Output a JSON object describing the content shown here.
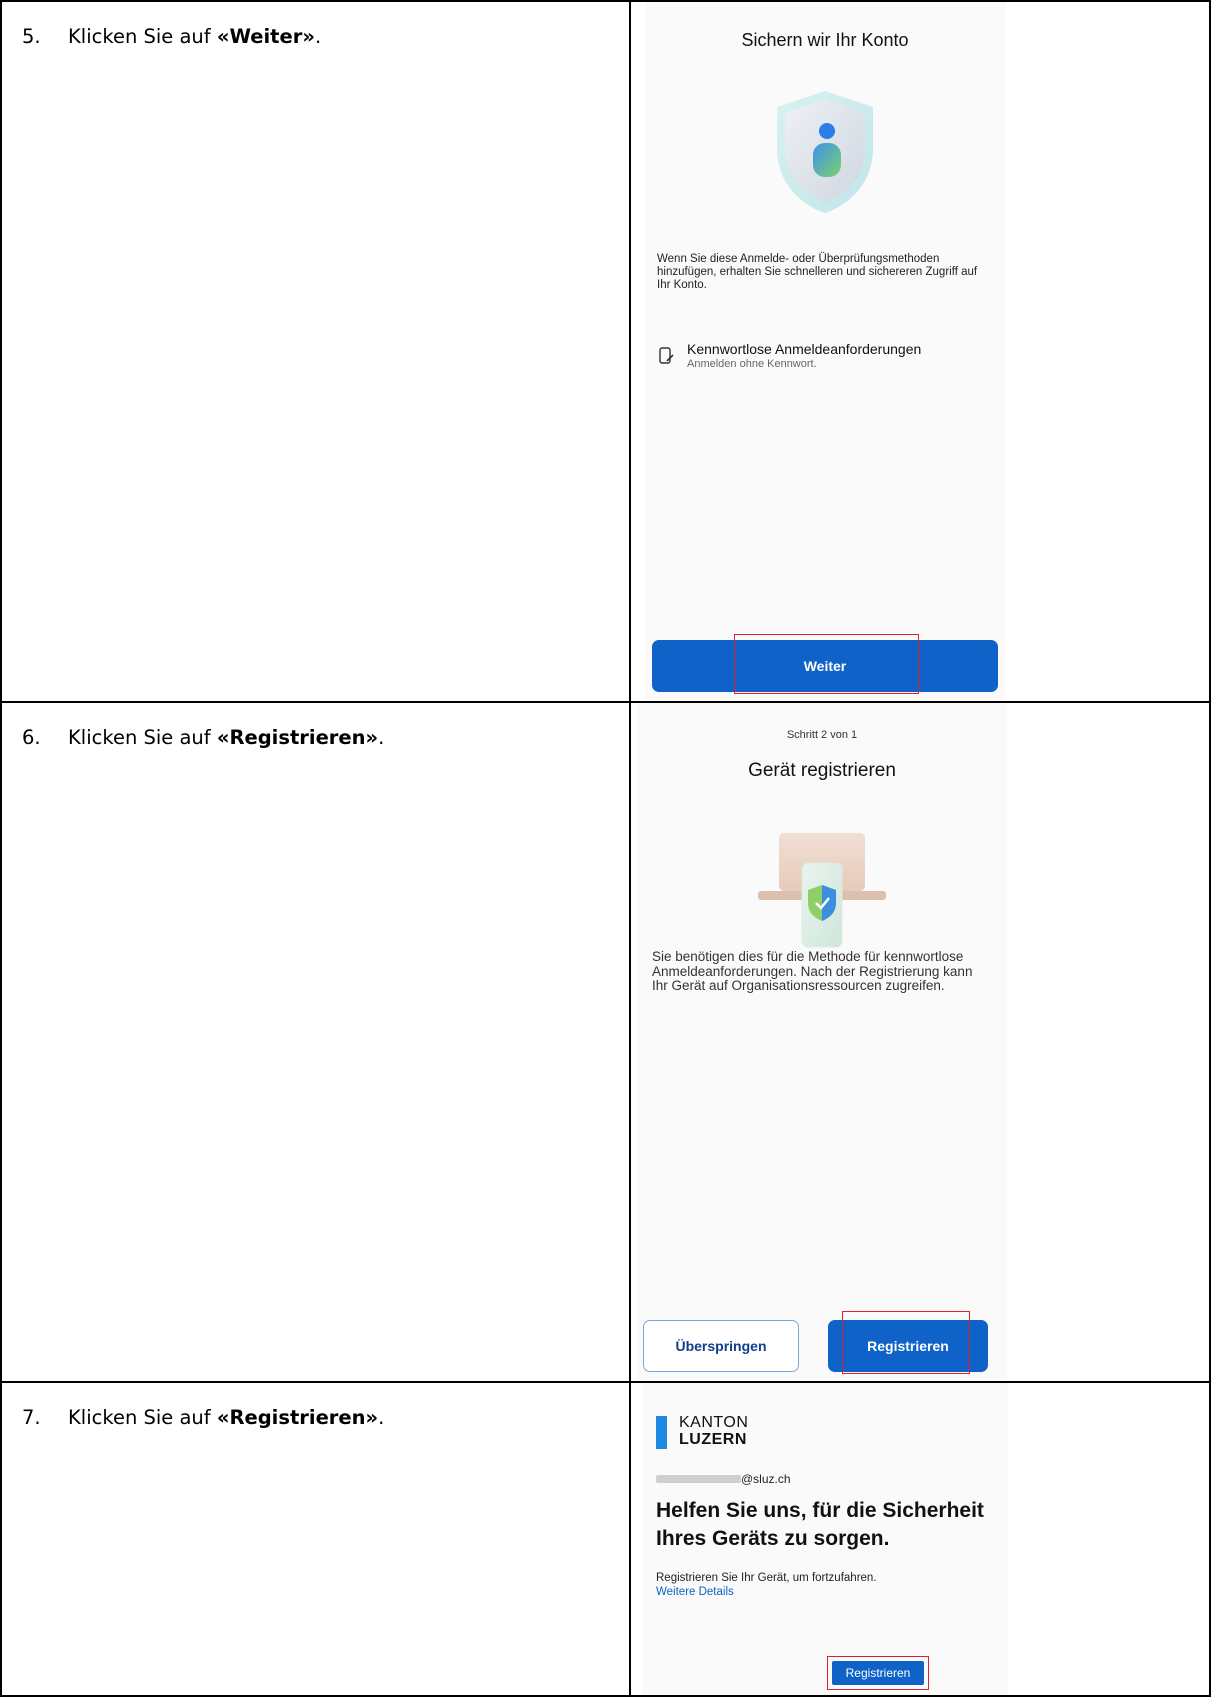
{
  "steps": [
    {
      "number": "5.",
      "instruction_prefix": "Klicken Sie auf ",
      "instruction_target": "«Weiter»",
      "instruction_suffix": ".",
      "screen": {
        "title": "Sichern wir Ihr Konto",
        "body": "Wenn Sie diese Anmelde- oder Überprüfungsmethoden hinzufügen, erhalten Sie schnelleren und sichereren Zugriff auf Ihr Konto.",
        "method_title": "Kennwortlose Anmeldeanforderungen",
        "method_subtitle": "Anmelden ohne Kennwort.",
        "method_icon": "phone-sign-in-icon",
        "illustration_icon": "shield-user-icon",
        "primary_button": "Weiter"
      }
    },
    {
      "number": "6.",
      "instruction_prefix": "Klicken Sie auf ",
      "instruction_target": "«Registrieren»",
      "instruction_suffix": ".",
      "screen": {
        "step_counter": "Schritt 2 von 1",
        "title": "Gerät registrieren",
        "illustration_icon": "laptop-phone-shield-icon",
        "body": "Sie benötigen dies für die Methode für kennwortlose Anmeldeanforderungen. Nach der Registrierung kann Ihr Gerät auf Organisationsressourcen zugreifen.",
        "secondary_button": "Überspringen",
        "primary_button": "Registrieren"
      }
    },
    {
      "number": "7.",
      "instruction_prefix": "Klicken Sie auf ",
      "instruction_target": "«Registrieren»",
      "instruction_suffix": ".",
      "screen": {
        "logo_line1": "KANTON",
        "logo_line2": "LUZERN",
        "email_domain": "@sluz.ch",
        "heading": "Helfen Sie uns, für die Sicherheit Ihres Geräts zu sorgen.",
        "body": "Registrieren Sie Ihr Gerät, um fortzufahren.",
        "link": "Weitere Details",
        "primary_button": "Registrieren"
      }
    }
  ],
  "colors": {
    "accent_blue": "#0f62c8",
    "highlight_red": "#e0202a",
    "link_blue": "#0b63c4",
    "logo_blue": "#1e88e5"
  }
}
